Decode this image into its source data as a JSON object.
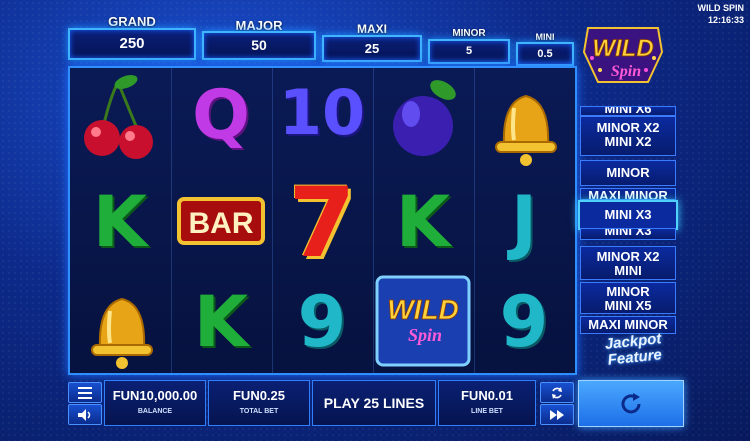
{
  "game": {
    "title": "WILD SPIN",
    "clock": "12:16:33"
  },
  "jackpots": [
    {
      "label": "GRAND",
      "value": "250"
    },
    {
      "label": "MAJOR",
      "value": "50"
    },
    {
      "label": "MAXI",
      "value": "25"
    },
    {
      "label": "MINOR",
      "value": "5"
    },
    {
      "label": "MINI",
      "value": "0.5"
    }
  ],
  "logo": {
    "line1": "WILD",
    "line2": "Spin"
  },
  "reels": [
    [
      "cherry",
      "K",
      "bell"
    ],
    [
      "Q",
      "BAR",
      "K"
    ],
    [
      "10",
      "7",
      "9"
    ],
    [
      "plum",
      "K",
      "wild"
    ],
    [
      "bell",
      "J",
      "9"
    ]
  ],
  "symbols": {
    "bar_text": "BAR",
    "wild_line1": "WILD",
    "wild_line2": "Spin"
  },
  "ladder": {
    "partial_top": "MINI X6",
    "items": [
      "MINOR X2\nMINI X2",
      "MINOR",
      "MAXI MINOR",
      "MINI X3",
      "MINI X3",
      "MINOR X2\nMINI",
      "MINOR\nMINI X5",
      "MAXI MINOR"
    ],
    "highlight_label": "MINI X3"
  },
  "feature_title": {
    "line1": "Jackpot",
    "line2": "Feature"
  },
  "bottom": {
    "balance": {
      "value": "FUN10,000.00",
      "label": "BALANCE"
    },
    "total_bet": {
      "value": "FUN0.25",
      "label": "TOTAL BET"
    },
    "play_label": "PLAY 25 LINES",
    "line_bet": {
      "value": "FUN0.01",
      "label": "LINE BET"
    }
  },
  "colors": {
    "accent": "#3fb4ff",
    "gold": "#f2c230",
    "red": "#d4142a",
    "green": "#1fae3a"
  }
}
